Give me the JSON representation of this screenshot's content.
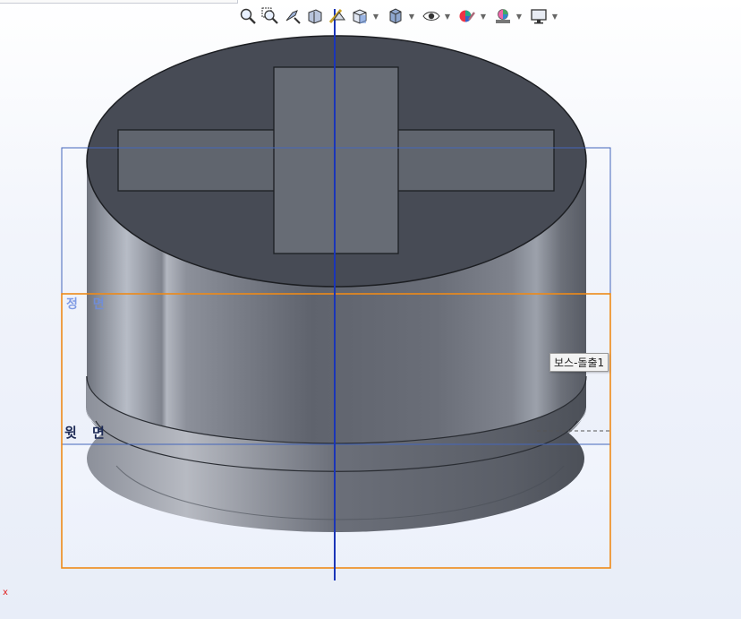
{
  "planes": {
    "front_label": "정 면",
    "top_label": "윗 면"
  },
  "tooltip": {
    "text": "보스-돌출1"
  },
  "origin": {
    "axis_label": "x"
  },
  "toolbar": {
    "items": [
      {
        "name": "zoom-to-fit-icon"
      },
      {
        "name": "zoom-to-area-icon"
      },
      {
        "name": "previous-view-icon"
      },
      {
        "name": "section-view-icon"
      },
      {
        "name": "dynamic-annotation-views-icon"
      },
      {
        "name": "view-orientation-icon"
      },
      {
        "name": "display-style-icon"
      },
      {
        "name": "hide-show-items-icon"
      },
      {
        "name": "edit-appearance-icon"
      },
      {
        "name": "apply-scene-icon"
      },
      {
        "name": "view-settings-icon"
      }
    ]
  },
  "colors": {
    "front_plane": "#6a8fd8",
    "top_plane": "#e88a1a",
    "axis": "#1a35b8",
    "model_body": "#6d717b",
    "model_top": "#4a4e58",
    "cross_boss": "#646972"
  }
}
